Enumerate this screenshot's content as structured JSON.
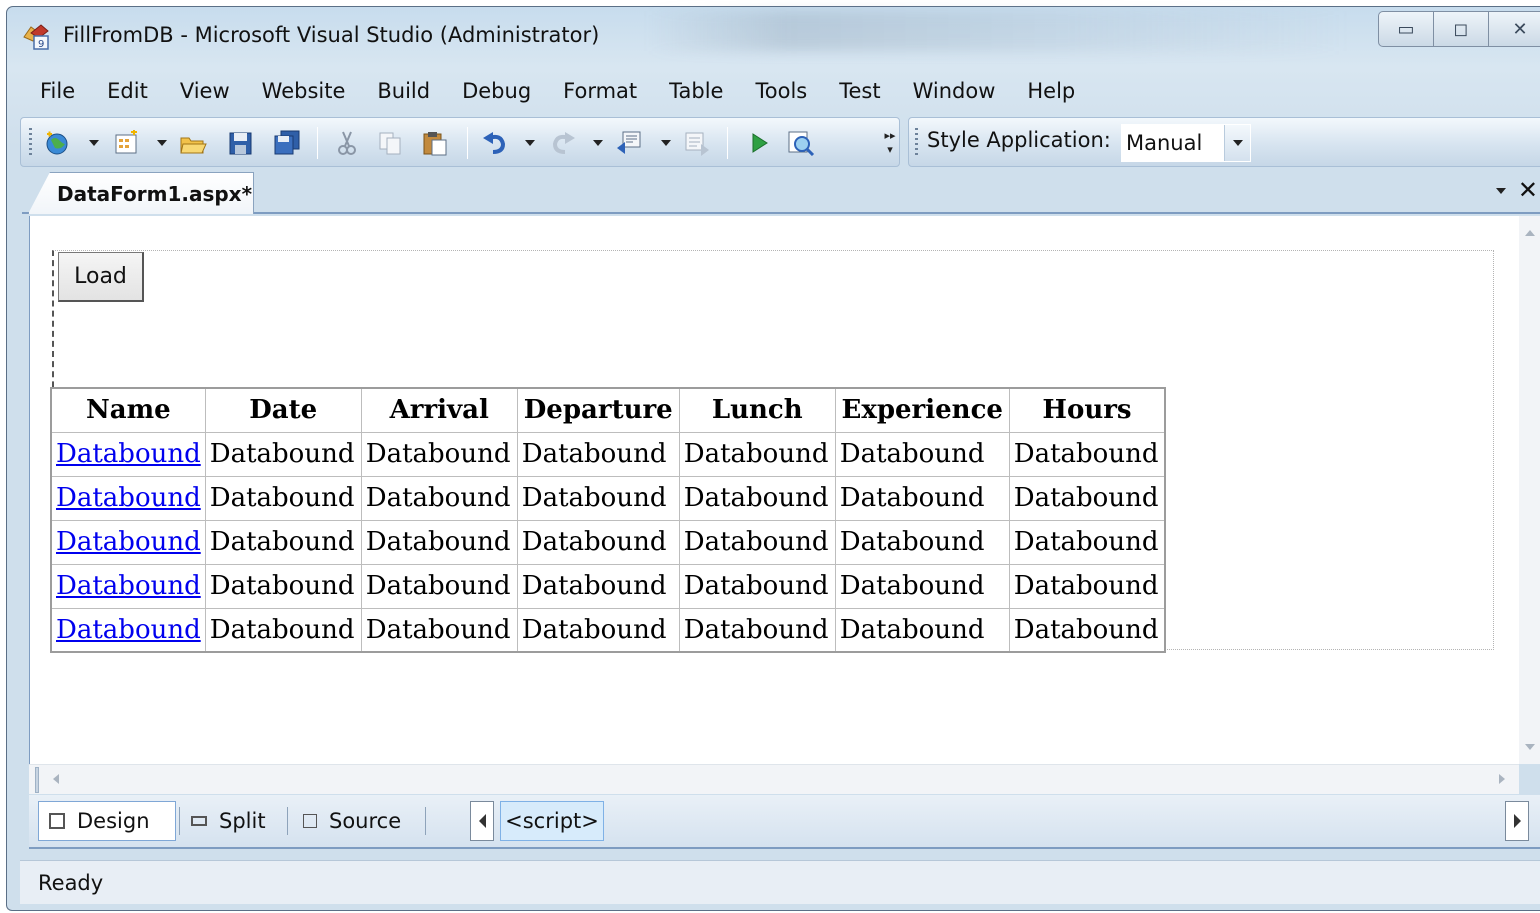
{
  "window": {
    "title": "FillFromDB - Microsoft Visual Studio (Administrator)",
    "caption_buttons": {
      "minimize": "▭",
      "maximize": "◻",
      "close": "✕"
    }
  },
  "menubar": {
    "items": [
      "File",
      "Edit",
      "View",
      "Website",
      "Build",
      "Debug",
      "Format",
      "Table",
      "Tools",
      "Test",
      "Window",
      "Help"
    ]
  },
  "toolbar": {
    "icons": [
      "new-website-icon",
      "add-item-icon",
      "open-file-icon",
      "save-icon",
      "save-all-icon",
      "cut-icon",
      "copy-icon",
      "paste-icon",
      "undo-icon",
      "redo-icon",
      "navigate-icon",
      "find-icon",
      "start-debugging-icon",
      "view-in-browser-icon"
    ]
  },
  "style_toolbar": {
    "label": "Style Application:",
    "value": "Manual"
  },
  "document": {
    "tab_label": "DataForm1.aspx*"
  },
  "designer": {
    "load_button": "Load",
    "grid": {
      "headers": [
        "Name",
        "Date",
        "Arrival",
        "Departure",
        "Lunch",
        "Experience",
        "Hours"
      ],
      "rows": [
        [
          "Databound",
          "Databound",
          "Databound",
          "Databound",
          "Databound",
          "Databound",
          "Databound"
        ],
        [
          "Databound",
          "Databound",
          "Databound",
          "Databound",
          "Databound",
          "Databound",
          "Databound"
        ],
        [
          "Databound",
          "Databound",
          "Databound",
          "Databound",
          "Databound",
          "Databound",
          "Databound"
        ],
        [
          "Databound",
          "Databound",
          "Databound",
          "Databound",
          "Databound",
          "Databound",
          "Databound"
        ],
        [
          "Databound",
          "Databound",
          "Databound",
          "Databound",
          "Databound",
          "Databound",
          "Databound"
        ]
      ]
    }
  },
  "viewbar": {
    "design": "Design",
    "split": "Split",
    "source": "Source",
    "tag": "<script>"
  },
  "status": {
    "text": "Ready"
  },
  "colors": {
    "link": "#0000ee",
    "chrome": "#cfdfec",
    "accent_border": "#7e9cc1"
  }
}
